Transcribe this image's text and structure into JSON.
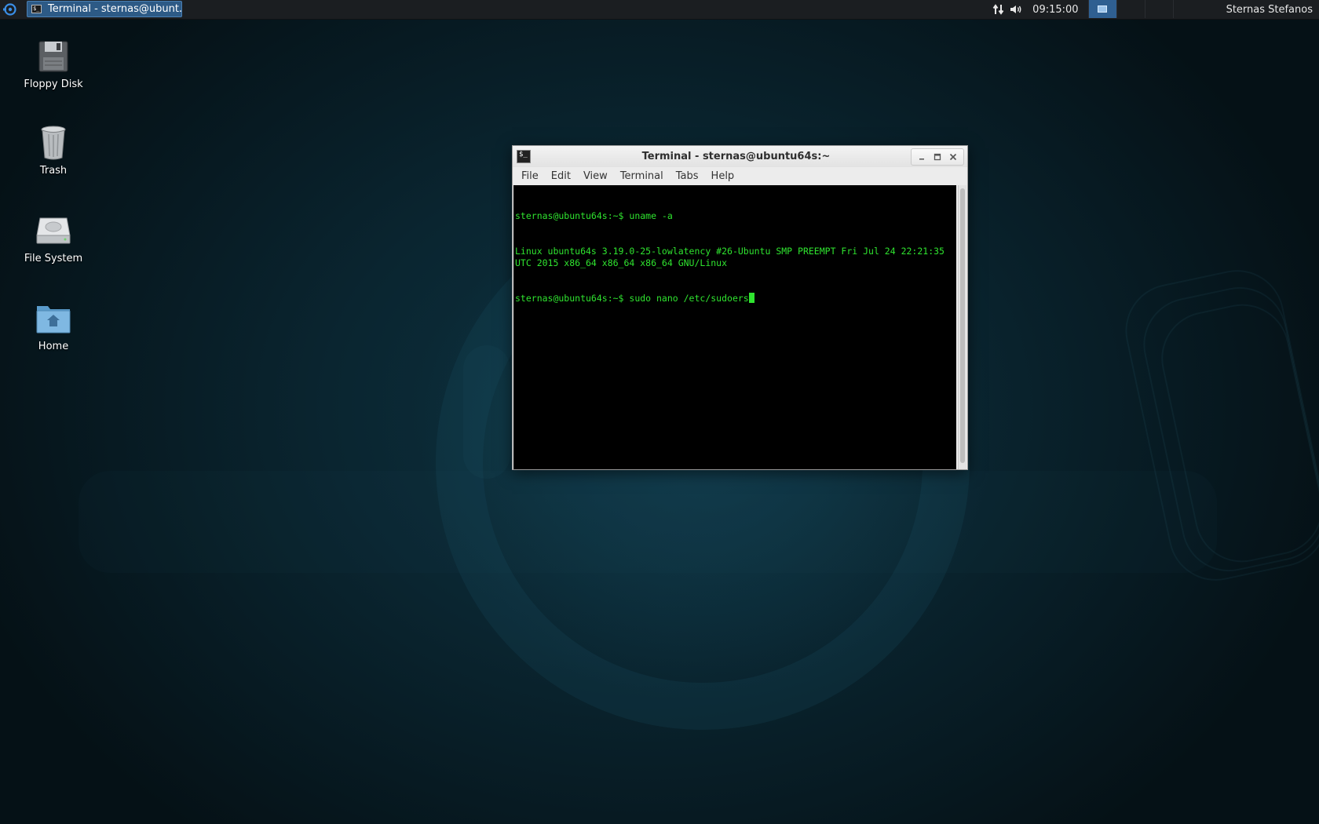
{
  "panel": {
    "task_button_label": "Terminal - sternas@ubunt...",
    "clock": "09:15:00",
    "user": "Sternas Stefanos",
    "workspaces": 4,
    "active_workspace": 1
  },
  "desktop": {
    "icons": [
      {
        "label": "Floppy Disk",
        "icon": "floppy-disk-icon"
      },
      {
        "label": "Trash",
        "icon": "trash-icon"
      },
      {
        "label": "File System",
        "icon": "hard-drive-icon"
      },
      {
        "label": "Home",
        "icon": "home-folder-icon"
      }
    ]
  },
  "terminal": {
    "title": "Terminal - sternas@ubuntu64s:~",
    "menu": [
      "File",
      "Edit",
      "View",
      "Terminal",
      "Tabs",
      "Help"
    ],
    "lines": [
      "sternas@ubuntu64s:~$ uname -a",
      "Linux ubuntu64s 3.19.0-25-lowlatency #26-Ubuntu SMP PREEMPT Fri Jul 24 22:21:35 UTC 2015 x86_64 x86_64 x86_64 GNU/Linux",
      "sternas@ubuntu64s:~$ sudo nano /etc/sudoers"
    ]
  },
  "colors": {
    "panel_bg": "#1b1e21",
    "task_button_bg": "#2d5a86",
    "terminal_fg": "#2fe42f",
    "terminal_bg": "#000000"
  }
}
